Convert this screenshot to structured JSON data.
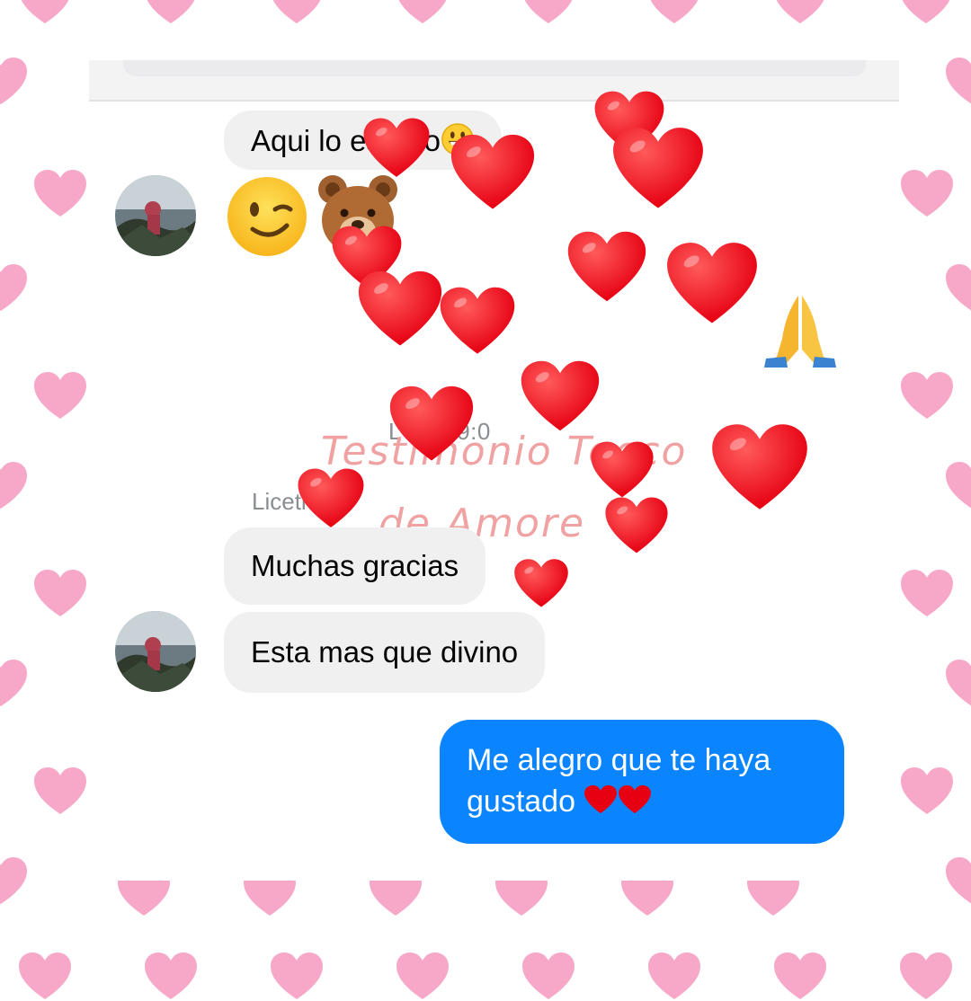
{
  "conversation": {
    "messages": [
      {
        "text": "Aqui lo espero",
        "emoji": "grinning-face"
      },
      {
        "emoji_row": [
          "winking-face",
          "bear-face"
        ]
      },
      {
        "emoji": "folded-hands"
      },
      {
        "sender": "Liceth",
        "text": "Muchas gracias"
      },
      {
        "text": "Esta mas que divino"
      },
      {
        "text_line1": "Me alegro que te haya",
        "text_line2": "gustado",
        "emoji": [
          "red-heart",
          "red-heart"
        ]
      }
    ],
    "timestamp": "LUN 19:0",
    "sender_name": "Liceth"
  },
  "watermark": {
    "line1": "Testimonio Tocco",
    "line2": "de Amore"
  },
  "colors": {
    "frame_heart": "#f7a8c8",
    "outgoing_bubble": "#0a84ff",
    "incoming_bubble": "#f0f0f0",
    "overlay_heart": "#e60012",
    "watermark": "#f0a2a2"
  }
}
